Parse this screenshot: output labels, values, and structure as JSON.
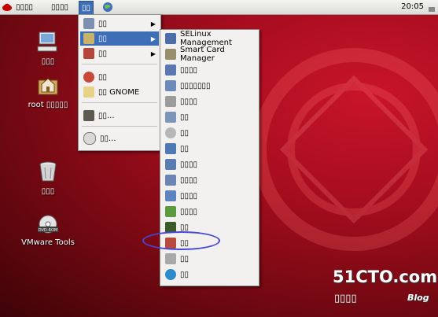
{
  "topbar": {
    "menus": [
      {
        "label": "▯▯▯▯"
      },
      {
        "label": "▯▯▯▯"
      },
      {
        "label": "▯▯"
      }
    ],
    "clock": "20:05"
  },
  "desktop_icons": [
    {
      "label": "▯▯▯",
      "icon": "computer-icon"
    },
    {
      "label": "root ▯▯▯▯▯",
      "icon": "home-folder-icon"
    },
    {
      "label": "▯▯▯",
      "icon": "trash-icon"
    },
    {
      "label": "VMware Tools",
      "icon": "cdrom-icon",
      "badge": "DVD-ROM"
    }
  ],
  "main_menu": {
    "items": [
      {
        "label": "▯▯",
        "icon": "applications-icon",
        "submenu": true
      },
      {
        "label": "▯▯",
        "icon": "preferences-icon",
        "submenu": true,
        "highlighted": true
      },
      {
        "label": "▯▯",
        "icon": "administration-icon",
        "submenu": true
      },
      {
        "label": "▯▯",
        "icon": "help-icon"
      },
      {
        "label": "▯▯ GNOME",
        "icon": "about-gnome-icon"
      },
      {
        "label": "▯▯...",
        "icon": "lock-screen-icon"
      },
      {
        "label": "▯▯...",
        "icon": "power-icon"
      }
    ]
  },
  "submenu": {
    "items": [
      {
        "label": "SELinux Management",
        "icon": "selinux-icon"
      },
      {
        "label": "Smart Card Manager",
        "icon": "smartcard-icon"
      },
      {
        "label": "▯▯▯▯",
        "icon": "sound-icon"
      },
      {
        "label": "▯▯▯▯▯▯▯",
        "icon": "network-icon"
      },
      {
        "label": "▯▯▯▯",
        "icon": "printer-icon"
      },
      {
        "label": "▯▯",
        "icon": "display-icon"
      },
      {
        "label": "▯▯",
        "icon": "date-time-icon"
      },
      {
        "label": "▯▯",
        "icon": "users-icon"
      },
      {
        "label": "▯▯▯▯",
        "icon": "keyboard-icon"
      },
      {
        "label": "▯▯▯▯",
        "icon": "network-config-icon"
      },
      {
        "label": "▯▯▯▯",
        "icon": "packages-icon"
      },
      {
        "label": "▯▯▯▯",
        "icon": "kickstart-icon"
      },
      {
        "label": "▯▯",
        "icon": "authentication-icon"
      },
      {
        "label": "▯▯",
        "icon": "services-icon"
      },
      {
        "label": "▯▯",
        "icon": "disk-icon"
      },
      {
        "label": "▯▯",
        "icon": "language-icon"
      }
    ]
  },
  "watermark": {
    "site": "51CTO.com",
    "tagline": "▯▯▯▯",
    "blog": "Blog"
  },
  "colors": {
    "highlight": "#3e6eb5",
    "desktop_red": "#a50d1e",
    "annotation_ellipse": "#4646d6"
  }
}
